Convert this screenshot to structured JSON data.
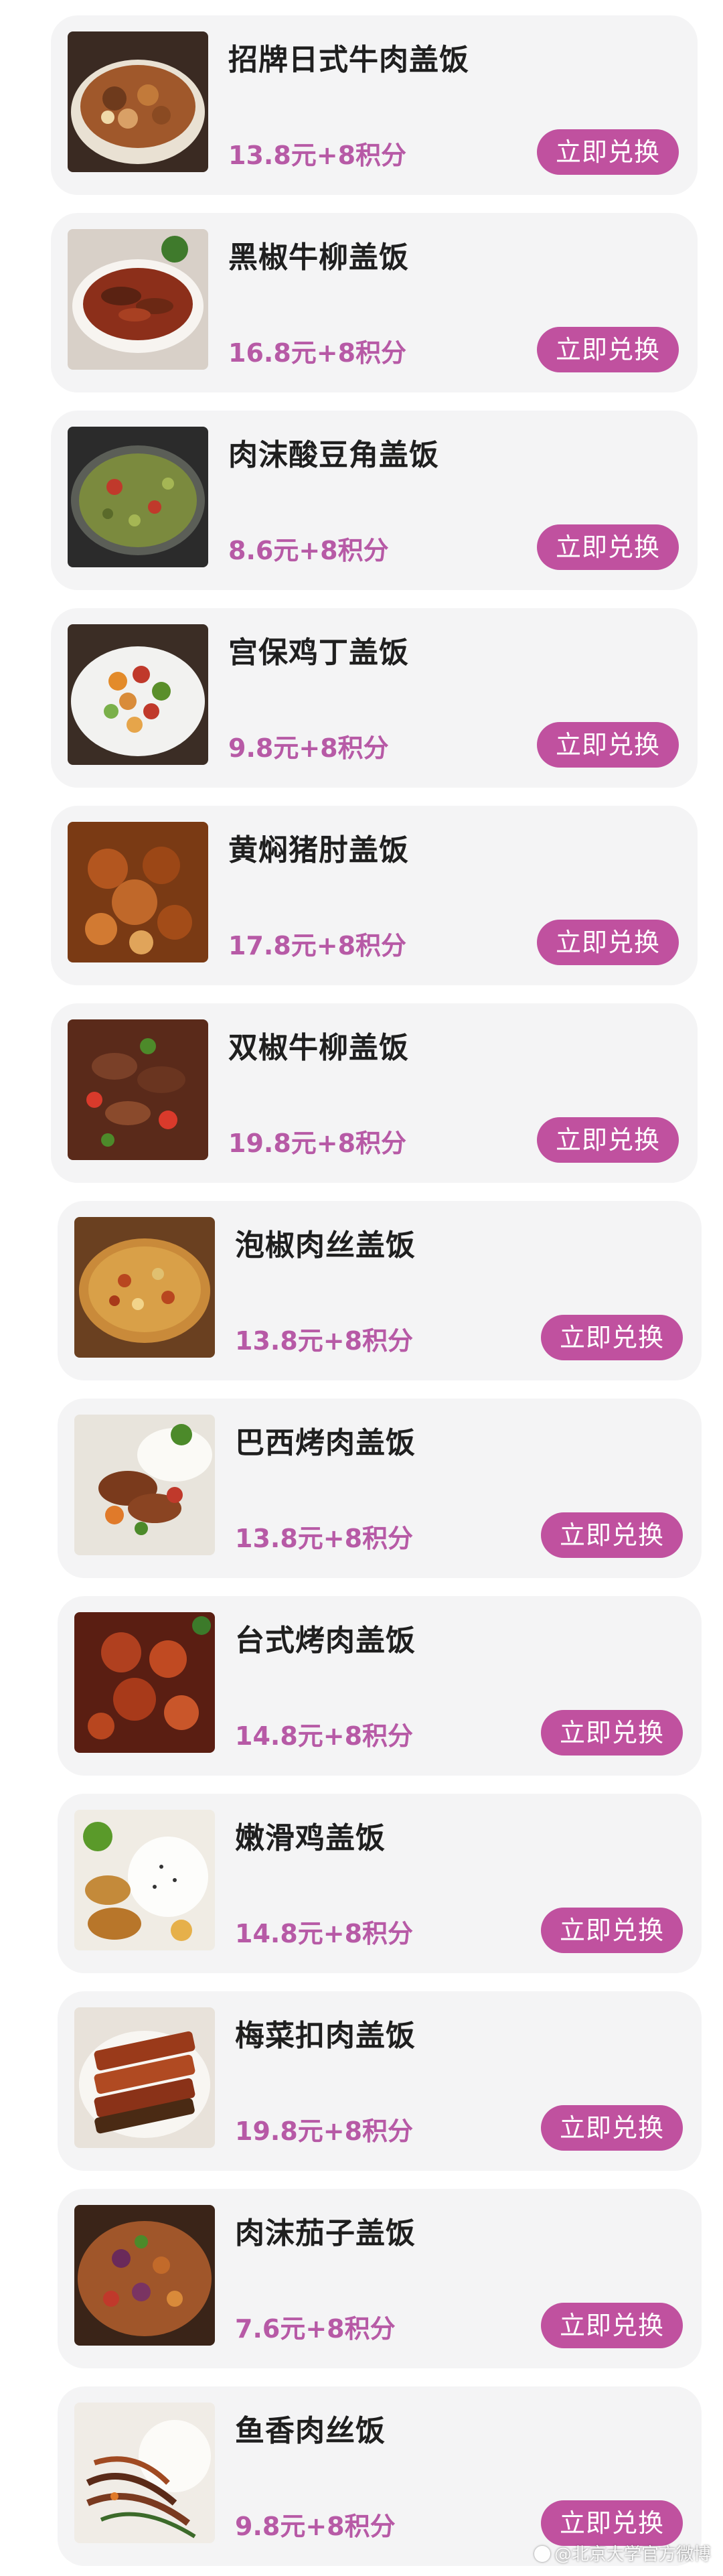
{
  "items": [
    {
      "title": "招牌日式牛肉盖饭",
      "price": "13.8元+8积分",
      "button": "立即兑换",
      "food_icon": "beef-rice-bowl"
    },
    {
      "title": "黑椒牛柳盖饭",
      "price": "16.8元+8积分",
      "button": "立即兑换",
      "food_icon": "black-pepper-beef"
    },
    {
      "title": "肉沫酸豆角盖饭",
      "price": "8.6元+8积分",
      "button": "立即兑换",
      "food_icon": "pickled-beans"
    },
    {
      "title": "宫保鸡丁盖饭",
      "price": "9.8元+8积分",
      "button": "立即兑换",
      "food_icon": "kung-pao-chicken"
    },
    {
      "title": "黄焖猪肘盖饭",
      "price": "17.8元+8积分",
      "button": "立即兑换",
      "food_icon": "braised-pork-knuckle"
    },
    {
      "title": "双椒牛柳盖饭",
      "price": "19.8元+8积分",
      "button": "立即兑换",
      "food_icon": "double-pepper-beef"
    },
    {
      "title": "泡椒肉丝盖饭",
      "price": "13.8元+8积分",
      "button": "立即兑换",
      "food_icon": "pickled-pepper-pork"
    },
    {
      "title": "巴西烤肉盖饭",
      "price": "13.8元+8积分",
      "button": "立即兑换",
      "food_icon": "brazilian-bbq"
    },
    {
      "title": "台式烤肉盖饭",
      "price": "14.8元+8积分",
      "button": "立即兑换",
      "food_icon": "taiwanese-bbq"
    },
    {
      "title": "嫩滑鸡盖饭",
      "price": "14.8元+8积分",
      "button": "立即兑换",
      "food_icon": "tender-chicken-rice"
    },
    {
      "title": "梅菜扣肉盖饭",
      "price": "19.8元+8积分",
      "button": "立即兑换",
      "food_icon": "preserved-veg-pork"
    },
    {
      "title": "肉沫茄子盖饭",
      "price": "7.6元+8积分",
      "button": "立即兑换",
      "food_icon": "eggplant-minced-pork"
    },
    {
      "title": "鱼香肉丝饭",
      "price": "9.8元+8积分",
      "button": "立即兑换",
      "food_icon": "yuxiang-pork"
    }
  ],
  "watermark": {
    "text": "@北京大学官方微博"
  },
  "colors": {
    "card_bg": "#f4f4f5",
    "price": "#b75aa6",
    "button_bg": "#c0519f",
    "button_text": "#ffffff",
    "title": "#1f1f1f"
  }
}
